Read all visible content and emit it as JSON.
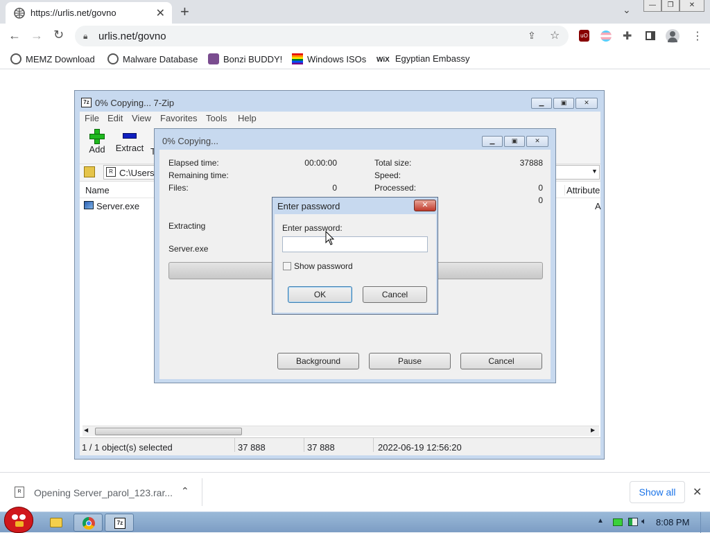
{
  "browser": {
    "tab_title": "https://urlis.net/govno",
    "url": "urlis.net/govno",
    "bookmarks": [
      {
        "label": "MEMZ Download"
      },
      {
        "label": "Malware Database"
      },
      {
        "label": "Bonzi BUDDY!"
      },
      {
        "label": "Windows ISOs"
      },
      {
        "label": "Egyptian Embassy"
      }
    ]
  },
  "zip_window": {
    "title": "0% Copying... 7-Zip",
    "capicon": "7z",
    "menu": [
      "File",
      "Edit",
      "View",
      "Favorites",
      "Tools",
      "Help"
    ],
    "tool_add": "Add",
    "tool_extract": "Extract",
    "tool_test": "T",
    "path": "C:\\Users\\",
    "col_name": "Name",
    "col_attributes": "Attribute",
    "file_name": "Server.exe",
    "attr_cut": "A",
    "status": {
      "selected": "1 / 1 object(s) selected",
      "size": "37 888",
      "packed": "37 888",
      "date": "2022-06-19 12:56:20"
    }
  },
  "copy_dialog": {
    "title": "0% Copying...",
    "elapsed_label": "Elapsed time:",
    "elapsed_value": "00:00:00",
    "remaining_label": "Remaining time:",
    "files_label": "Files:",
    "files_value": "0",
    "total_label": "Total size:",
    "total_value": "37888",
    "speed_label": "Speed:",
    "processed_label": "Processed:",
    "processed_value": "0",
    "extra_value": "0",
    "action": "Extracting",
    "current_file": "Server.exe",
    "progress_percent": 0,
    "btn_background": "Background",
    "btn_pause": "Pause",
    "btn_cancel": "Cancel"
  },
  "password_dialog": {
    "title": "Enter password",
    "prompt": "Enter password:",
    "value": "",
    "show_password": "Show password",
    "show_password_checked": false,
    "ok": "OK",
    "cancel": "Cancel"
  },
  "download": {
    "filename": "Opening Server_parol_123.rar...",
    "show_all": "Show all"
  },
  "taskbar": {
    "time": "8:08 PM",
    "zip_label": "7z"
  }
}
